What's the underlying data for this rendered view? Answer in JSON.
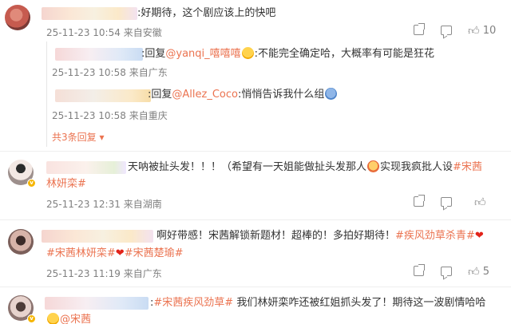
{
  "comments": [
    {
      "text": ":好期待，这个剧应该上的快吧",
      "date": "25-11-23 10:54",
      "source": "来自安徽",
      "likes": "10",
      "replies": [
        {
          "text_prefix": ":回复",
          "mention": "@yanqi_嘻嘻嘻",
          "text_suffix": ":不能完全确定哈，大概率有可能是狂花",
          "date": "25-11-23 10:58",
          "source": "来自广东"
        },
        {
          "text_prefix": ":回复",
          "mention": "@Allez_Coco",
          "text_suffix": ":悄悄告诉我什么组",
          "date": "25-11-23 10:58",
          "source": "来自重庆"
        }
      ],
      "replies_link": "共3条回复"
    },
    {
      "text_a": "天呐被扯头发！！！（希望有一天姐能做扯头发那人",
      "text_b": "实现我疯批人设",
      "topic_a": "#宋茜",
      "line2_topic": "林妍栾#",
      "date": "25-11-23 12:31",
      "source": "来自湖南"
    },
    {
      "text_a": "啊好带感！宋茜解锁新题材！超棒的！多拍好期待！",
      "topic_a": "#疾风劲草杀青#",
      "line2_topic_a": "#宋茜林妍栾#",
      "line2_topic_b": "#宋茜楚瑜#",
      "date": "25-11-23 11:19",
      "source": "来自广东",
      "likes": "5"
    },
    {
      "prefix": ":",
      "topic_a": "#宋茜疾风劲草#",
      "text_a": "我们林妍栾咋还被红姐抓头发了！期待这一波剧情哈哈",
      "line2_mention": "@宋茜"
    }
  ],
  "icons": {
    "share": "share-icon",
    "comment": "comment-icon",
    "like": "thumbs-up-icon",
    "dropdown": "caret-down-icon"
  },
  "colors": {
    "link": "#eb7350",
    "meta": "#808080",
    "text": "#333333"
  }
}
